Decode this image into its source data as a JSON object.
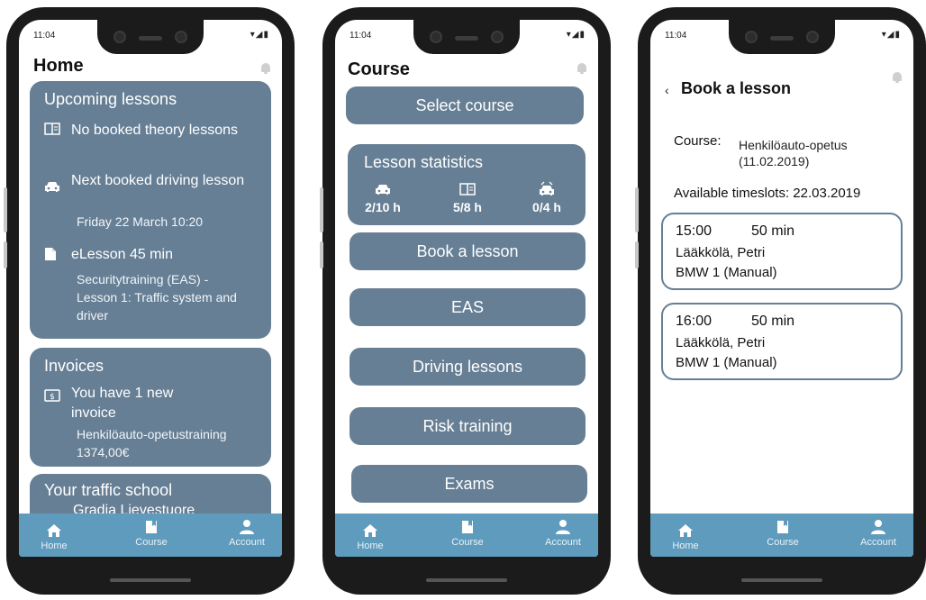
{
  "status": {
    "time": "11:04",
    "icons": "▾◢▮"
  },
  "home": {
    "title": "Home",
    "upcoming": {
      "heading": "Upcoming lessons",
      "theory": "No booked theory lessons",
      "driving_title": "Next booked driving lesson",
      "driving_date": "Friday 22 March 10:20",
      "elesson_title": "eLesson 45 min",
      "elesson_desc": "Securitytraining (EAS) - Lesson 1: Traffic system and driver"
    },
    "invoices": {
      "heading": "Invoices",
      "new_text": "You have 1 new invoice",
      "detail": "Henkilöauto-opetustraining  1374,00€"
    },
    "school": {
      "heading": "Your traffic school",
      "name": "Gradia Lievestuore"
    }
  },
  "course": {
    "title": "Course",
    "select": "Select course",
    "stats_heading": "Lesson statistics",
    "stats": [
      {
        "icon": "car-icon",
        "value": "2/10 h"
      },
      {
        "icon": "book-icon",
        "value": "5/8 h"
      },
      {
        "icon": "risk-car-icon",
        "value": "0/4 h"
      }
    ],
    "buttons": [
      "Book a lesson",
      "EAS",
      "Driving lessons",
      "Risk training",
      "Exams"
    ]
  },
  "book": {
    "back": "‹",
    "title": "Book a lesson",
    "course_label": "Course:",
    "course_value": "Henkilöauto-opetus (11.02.2019)",
    "avail_label": "Available timeslots:",
    "avail_date": "22.03.2019",
    "slots": [
      {
        "time": "15:00",
        "duration": "50 min",
        "instructor": "Lääkkölä, Petri",
        "car": "BMW 1 (Manual)"
      },
      {
        "time": "16:00",
        "duration": "50 min",
        "instructor": "Lääkkölä, Petri",
        "car": "BMW 1 (Manual)"
      }
    ]
  },
  "nav": {
    "home": "Home",
    "course": "Course",
    "account": "Account"
  },
  "colors": {
    "card": "#667f95",
    "nav": "#5f9bbd",
    "frame": "#1b1b1b"
  }
}
